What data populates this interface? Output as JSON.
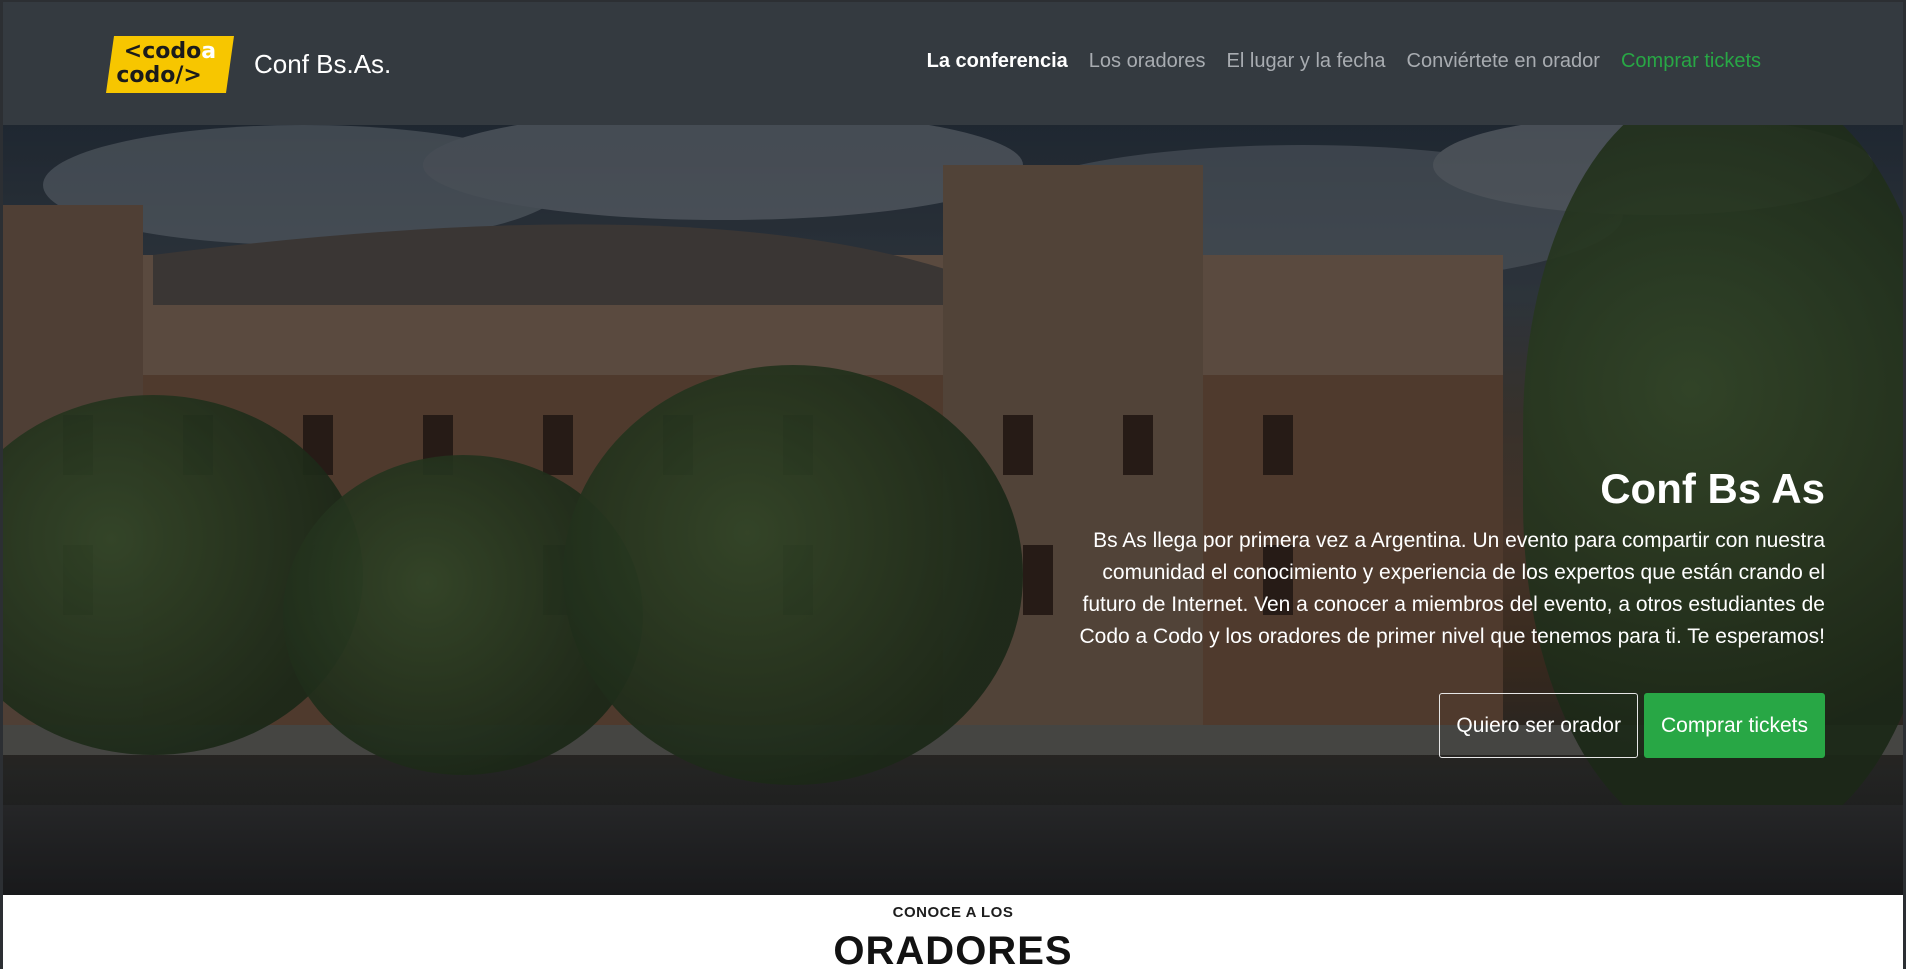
{
  "brand": {
    "logo_text_line1": "<codo",
    "logo_text_a": "a",
    "logo_text_line2": "codo/>",
    "title": "Conf Bs.As."
  },
  "nav": {
    "items": [
      {
        "label": "La conferencia",
        "state": "active"
      },
      {
        "label": "Los oradores"
      },
      {
        "label": "El lugar y la fecha"
      },
      {
        "label": "Conviértete en orador"
      },
      {
        "label": "Comprar tickets",
        "accent": "#28a745"
      }
    ]
  },
  "hero": {
    "title": "Conf Bs As",
    "text": "Bs As llega por primera vez a Argentina. Un evento para compartir con nuestra comunidad el conocimiento y experiencia de los expertos que están crando el futuro de Internet. Ven a conocer a miembros del evento, a otros estudiantes de Codo a Codo y los oradores de primer nivel que tenemos para ti. Te esperamos!",
    "btn_speaker": "Quiero ser orador",
    "btn_tickets": "Comprar tickets"
  },
  "speakers": {
    "kicker": "CONOCE A LOS",
    "title": "ORADORES"
  },
  "colors": {
    "navbar": "#343a40",
    "accent_green": "#28a745",
    "logo_yellow": "#f7c600"
  }
}
